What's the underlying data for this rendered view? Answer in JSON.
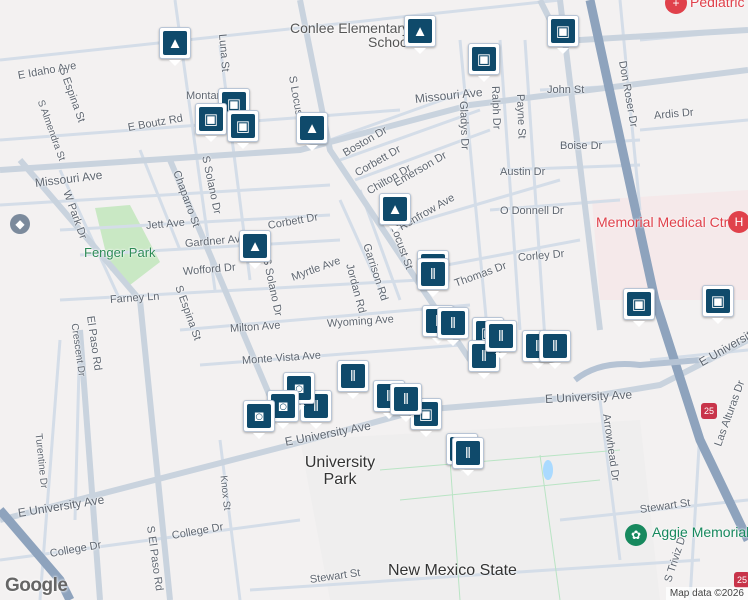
{
  "map": {
    "streets": [
      "Conlee Elementary",
      "School",
      "E Idaho Ave",
      "Missouri Ave",
      "Missouri Ave",
      "Luna St",
      "S Espina St",
      "S Almendra St",
      "Montana Ave",
      "E Boutz Rd",
      "S Locust St",
      "Boston Dr",
      "Corbett Dr",
      "Chilton Dr",
      "Gladys Dr",
      "Ralph Dr",
      "Payne St",
      "John St",
      "Boise Dr",
      "Austin Dr",
      "O Donnell Dr",
      "Corley Dr",
      "Ardis Dr",
      "Don Roser Dr",
      "Renfrow Ave",
      "Jett Ave",
      "Gardner Ave",
      "Wofford Dr",
      "Myrtle Ave",
      "Garrison Rd",
      "Jordan Rd",
      "Farney Ln",
      "Milton Ave",
      "Wyoming Ave",
      "Monte Vista Ave",
      "Chaparro St",
      "W Park Dr",
      "S Solano Dr",
      "S Espina St",
      "El Paso Rd",
      "Crescent Dr",
      "Turentine Dr",
      "Knox St",
      "E University Ave",
      "E University Ave",
      "E University Ave",
      "E University Ave",
      "S El Paso Rd",
      "College Dr",
      "College Dr",
      "Stewart St",
      "Stewart St",
      "S Triviz Dr",
      "Las Alturas Dr",
      "Arrowhead Dr",
      "Thomas Dr",
      "S Locust St",
      "S Solano Dr",
      "Corbett Dr",
      "Emerson Dr"
    ],
    "parks": {
      "fenger": "Fenger Park"
    },
    "areas": {
      "university_park": "University Park",
      "nmsu": "New Mexico State"
    },
    "poi": {
      "medical": "Memorial Medical Ctr",
      "pediatric": "Pediatric",
      "aggie": "Aggie Memorial"
    },
    "highway_shield": "25",
    "attribution": "Map data ©2026",
    "logo": "Google",
    "marker_icons": {
      "school": "graduation-cap-icon",
      "grocery": "shopping-bag-icon",
      "restaurant": "fork-knife-icon",
      "cafe": "coffee-cup-icon"
    },
    "colors": {
      "marker": "#0f4a6b",
      "freeway": "#8ea3bd",
      "medical": "#e0414b",
      "memorial": "#17895e",
      "park": "#c9e8c4"
    }
  }
}
